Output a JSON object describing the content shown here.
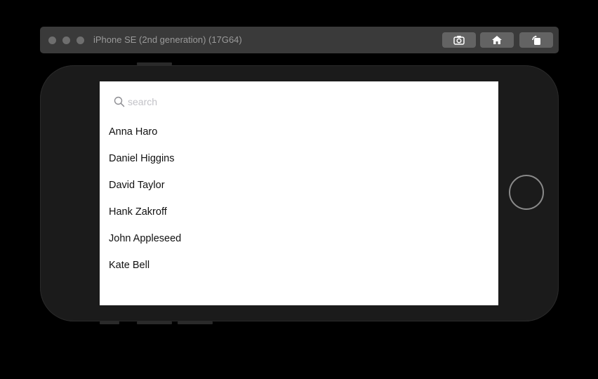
{
  "window": {
    "title": "iPhone SE (2nd generation) (17G64)",
    "toolbar_buttons": [
      {
        "name": "screenshot",
        "icon": "camera-icon"
      },
      {
        "name": "home",
        "icon": "home-icon"
      },
      {
        "name": "rotate",
        "icon": "rotate-icon"
      }
    ]
  },
  "search": {
    "placeholder": "search",
    "value": ""
  },
  "contacts": [
    {
      "name": "Anna Haro"
    },
    {
      "name": "Daniel Higgins"
    },
    {
      "name": "David Taylor"
    },
    {
      "name": "Hank Zakroff"
    },
    {
      "name": "John Appleseed"
    },
    {
      "name": "Kate Bell"
    }
  ],
  "colors": {
    "background": "#000000",
    "titlebar": "#3a3a3a",
    "device_body": "#1b1b1b",
    "screen": "#ffffff",
    "text": "#111111",
    "placeholder": "#c2c2c7"
  }
}
